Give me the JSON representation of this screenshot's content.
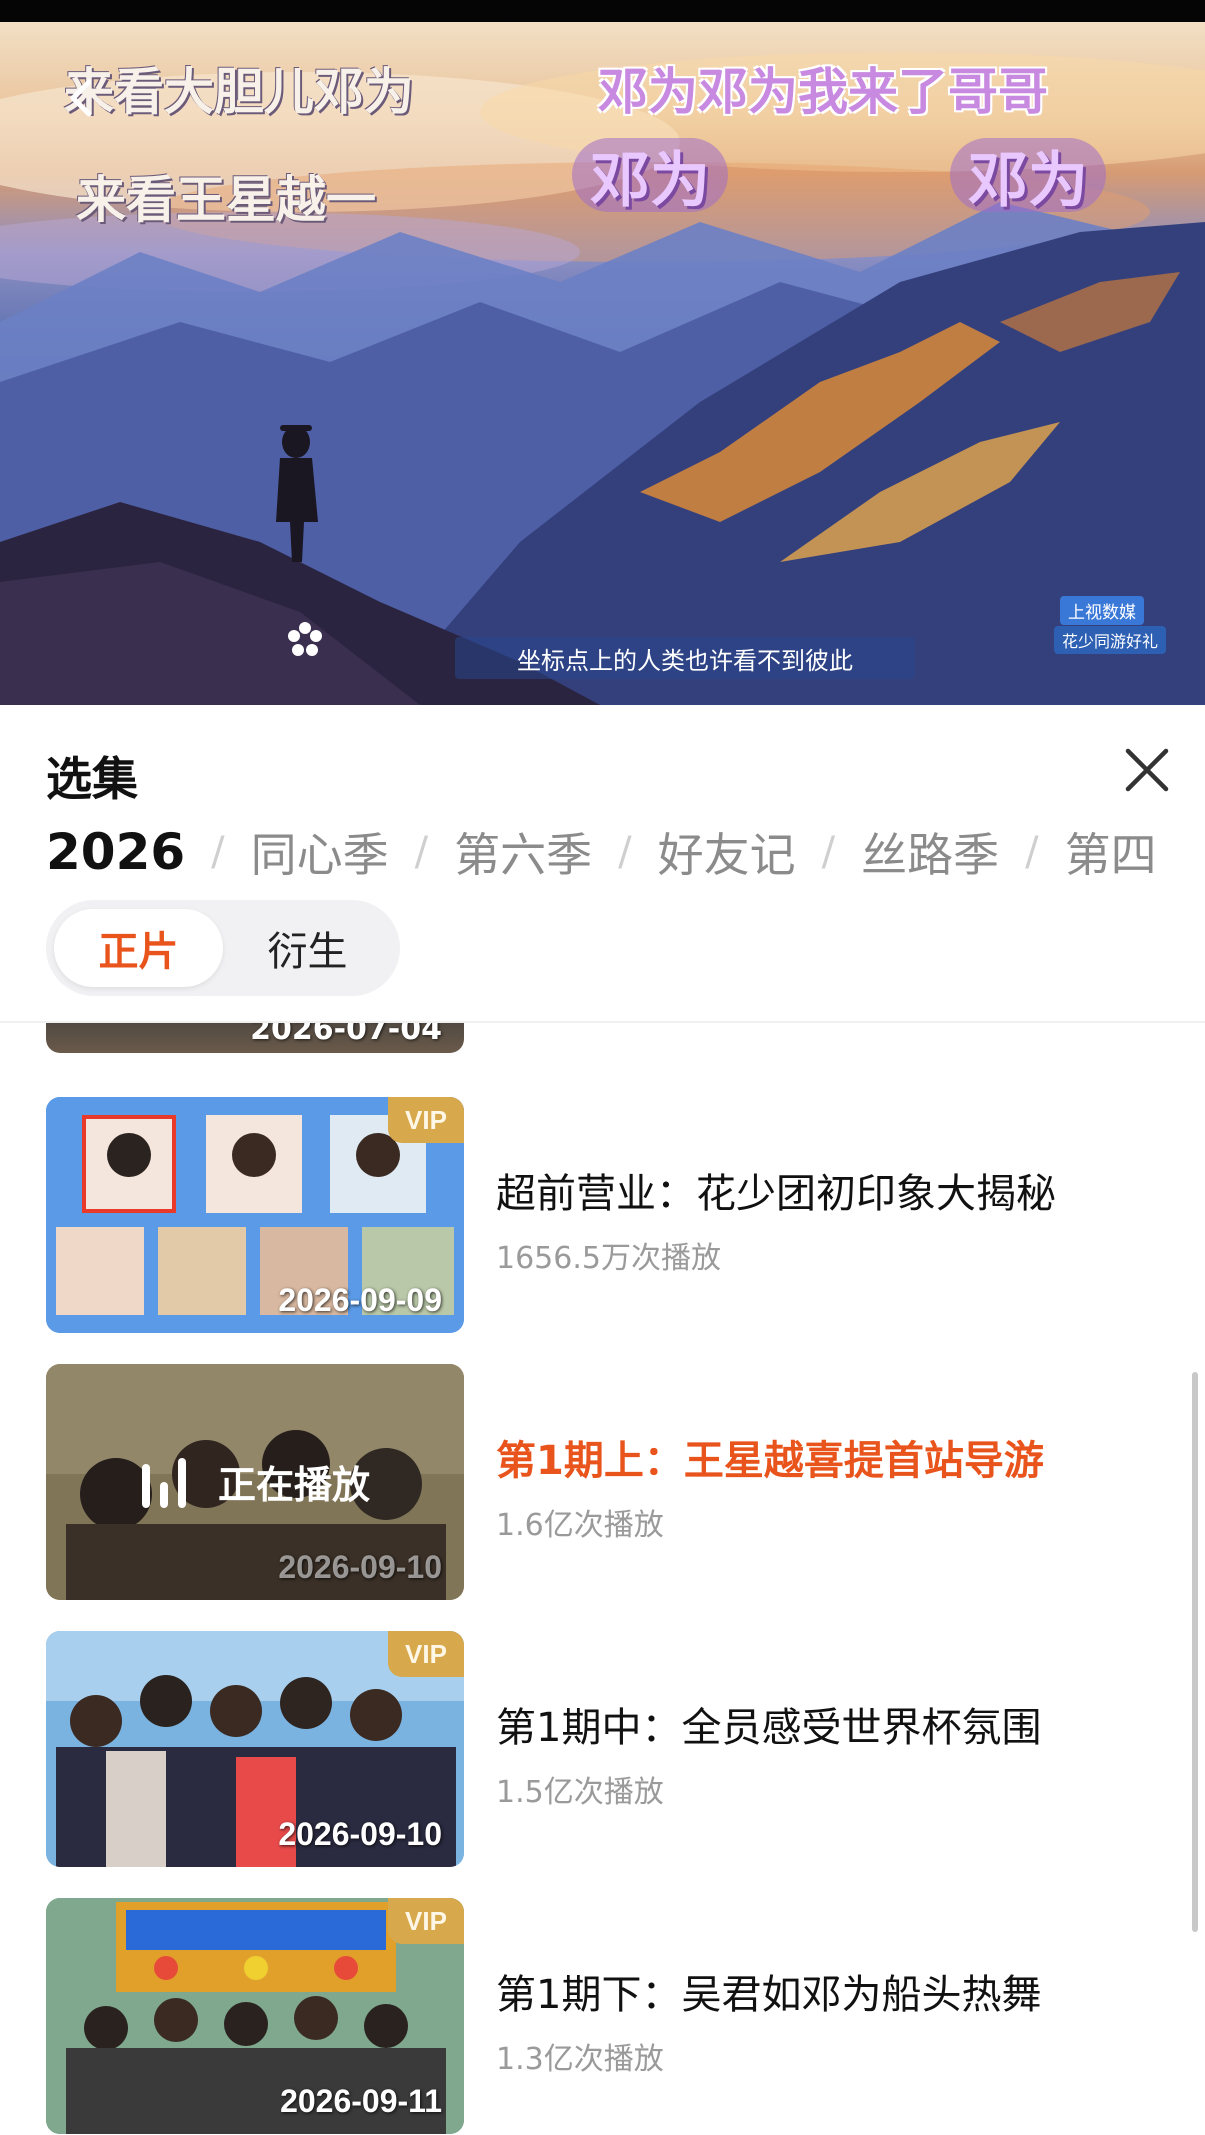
{
  "player": {
    "overlay_texts": [
      "来看大胆儿邓为",
      "来看王星越一"
    ],
    "pink_banner": "邓为邓为我来了哥哥",
    "stickers": [
      "邓为",
      "邓为"
    ],
    "subtitle": "坐标点上的人类也许看不到彼此",
    "corner_badge_top": "上视数媒",
    "corner_badge_bottom": "花少同游好礼"
  },
  "panel": {
    "title": "选集",
    "seasons": [
      "2026",
      "同心季",
      "第六季",
      "好友记",
      "丝路季",
      "第四"
    ],
    "active_season_index": 0,
    "types": [
      "正片",
      "衍生"
    ],
    "active_type_index": 0,
    "partial_item_date": "2026-07-04",
    "episodes": [
      {
        "title": "超前营业：花少团初印象大揭秘",
        "plays": "1656.5万次播放",
        "date": "2026-09-09",
        "vip": "VIP",
        "playing": false
      },
      {
        "title": "第1期上：王星越喜提首站导游",
        "plays": "1.6亿次播放",
        "date": "2026-09-10",
        "vip": "",
        "playing": true,
        "playing_label": "正在播放"
      },
      {
        "title": "第1期中：全员感受世界杯氛围",
        "plays": "1.5亿次播放",
        "date": "2026-09-10",
        "vip": "VIP",
        "playing": false
      },
      {
        "title": "第1期下：吴君如邓为船头热舞",
        "plays": "1.3亿次播放",
        "date": "2026-09-11",
        "vip": "VIP",
        "playing": false
      }
    ],
    "accent_color": "#e8541c"
  }
}
